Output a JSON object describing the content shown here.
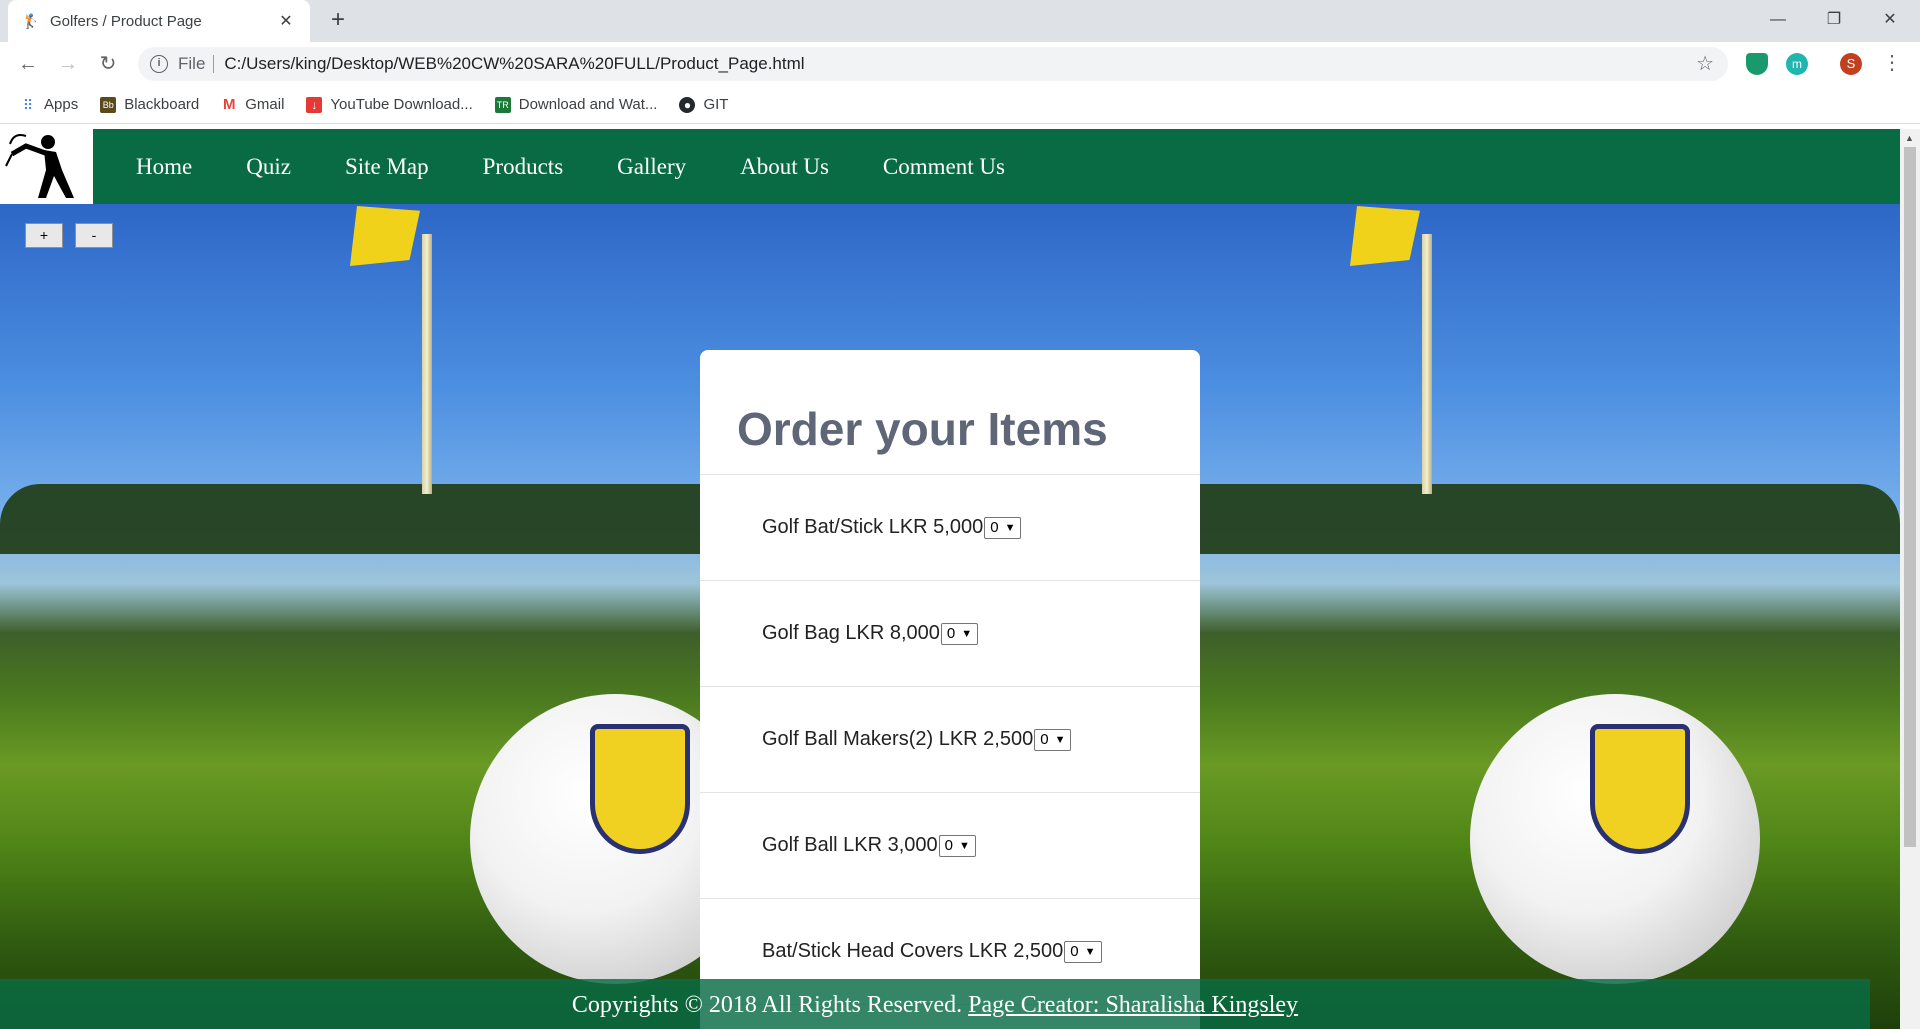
{
  "browser": {
    "tab_title": "Golfers / Product Page",
    "url_scheme": "File",
    "url": "C:/Users/king/Desktop/WEB%20CW%20SARA%20FULL/Product_Page.html",
    "profile_initial": "S",
    "bookmarks": [
      {
        "label": "Apps",
        "icon": "apps-grid-icon",
        "color": "#4285f4"
      },
      {
        "label": "Blackboard",
        "icon": "blackboard-icon",
        "color": "#5a4a1e"
      },
      {
        "label": "Gmail",
        "icon": "gmail-icon",
        "color": "#ea4335"
      },
      {
        "label": "YouTube Download...",
        "icon": "download-icon",
        "color": "#e53935"
      },
      {
        "label": "Download and Wat...",
        "icon": "tr-icon",
        "color": "#1b7a3a"
      },
      {
        "label": "GIT",
        "icon": "github-icon",
        "color": "#24292e"
      }
    ]
  },
  "nav": {
    "links": [
      "Home",
      "Quiz",
      "Site Map",
      "Products",
      "Gallery",
      "About Us",
      "Comment Us"
    ],
    "bg_color": "#086b44"
  },
  "zoom": {
    "plus": "+",
    "minus": "-"
  },
  "order": {
    "title": "Order your Items",
    "items": [
      {
        "label": "Golf Bat/Stick LKR 5,000",
        "qty": "0"
      },
      {
        "label": "Golf Bag LKR 8,000",
        "qty": "0"
      },
      {
        "label": "Golf Ball Makers(2) LKR 2,500",
        "qty": "0"
      },
      {
        "label": "Golf Ball LKR 3,000",
        "qty": "0"
      },
      {
        "label": "Bat/Stick Head Covers LKR 2,500",
        "qty": "0"
      }
    ]
  },
  "footer": {
    "copyright": "Copyrights © 2018 All Rights Reserved.",
    "creator": "Page Creator: Sharalisha Kingsley"
  }
}
